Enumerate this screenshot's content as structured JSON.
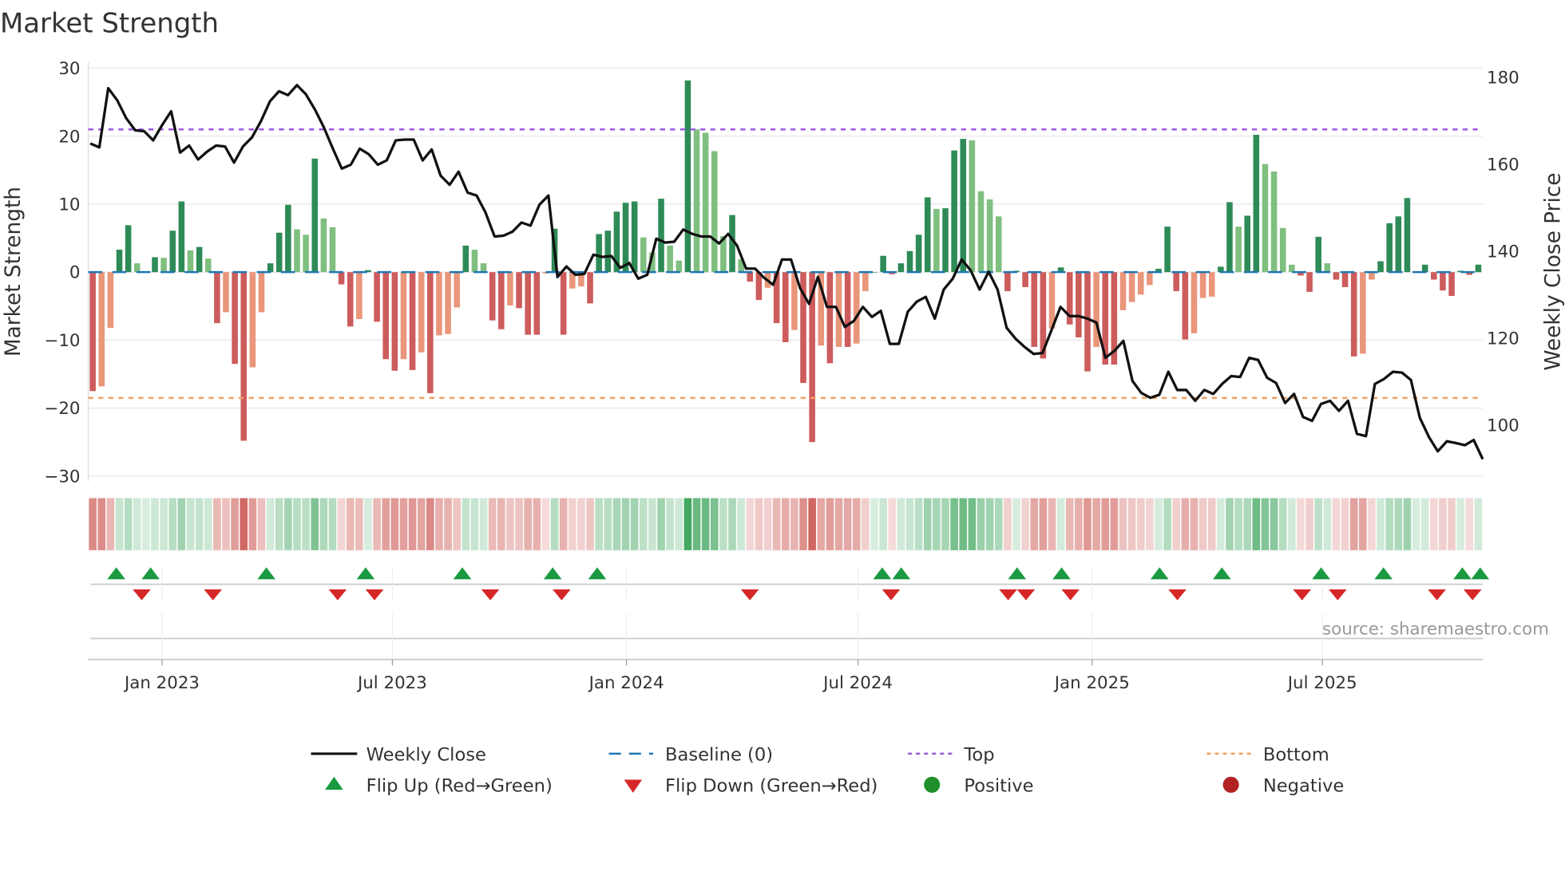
{
  "chart_data": {
    "type": "bar",
    "title": "Market Strength",
    "ylabel": "Market Strength",
    "y2label": "Weekly Close Price",
    "ylim": [
      -30,
      30
    ],
    "y2lim": [
      88.3,
      182.1
    ],
    "yticks": [
      30,
      20,
      10,
      0,
      -10,
      -20,
      -30
    ],
    "ytick_labels": [
      "30",
      "20",
      "10",
      "0",
      "−10",
      "−20",
      "−30"
    ],
    "y2ticks": [
      180,
      160,
      140,
      120,
      100
    ],
    "x_range": [
      "2022-11-04",
      "2025-11-04"
    ],
    "xticks": [
      {
        "date": "2023-01-01",
        "label": "Jan 2023"
      },
      {
        "date": "2023-07-01",
        "label": "Jul 2023"
      },
      {
        "date": "2024-01-01",
        "label": "Jan 2024"
      },
      {
        "date": "2024-07-01",
        "label": "Jul 2024"
      },
      {
        "date": "2025-01-01",
        "label": "Jan 2025"
      },
      {
        "date": "2025-07-01",
        "label": "Jul 2025"
      }
    ],
    "top_level": 21,
    "bottom_level": -18.5,
    "baseline": 0,
    "strength": [
      -17.5,
      -16.8,
      -8.2,
      3.3,
      6.9,
      1.3,
      0,
      2.2,
      2.1,
      6.1,
      10.4,
      3.2,
      3.7,
      2.0,
      -7.5,
      -5.9,
      -13.5,
      -24.8,
      -14,
      -5.9,
      1.3,
      5.8,
      9.9,
      6.3,
      5.5,
      16.7,
      7.9,
      6.6,
      -1.8,
      -8,
      -6.9,
      0.3,
      -7.3,
      -12.8,
      -14.5,
      -12.8,
      -14.4,
      -11.8,
      -17.8,
      -9.3,
      -9.1,
      -5.2,
      3.9,
      3.3,
      1.3,
      -7.1,
      -8.4,
      -4.9,
      -5.3,
      -9.2,
      -9.2,
      -0.2,
      6.4,
      -9.2,
      -2.4,
      -2.1,
      -4.6,
      5.6,
      6.1,
      8.9,
      10.2,
      10.4,
      5.1,
      2.9,
      10.8,
      3.9,
      1.7,
      28.2,
      21,
      20.5,
      17.8,
      5.3,
      8.4,
      1.9,
      -1.4,
      -4.1,
      -2.3,
      -7.5,
      -10.3,
      -8.5,
      -16.3,
      -25,
      -10.8,
      -13.4,
      -11,
      -11,
      -10.5,
      -2.8,
      0,
      2.4,
      -0.3,
      1.3,
      3.1,
      5.5,
      11,
      9.3,
      9.4,
      17.9,
      19.6,
      19.4,
      11.9,
      10.7,
      8.2,
      -2.8,
      0.2,
      -2.2,
      -11,
      -12.7,
      -8.3,
      0.7,
      -7.7,
      -9.6,
      -14.6,
      -11,
      -13.6,
      -13.6,
      -5.6,
      -4.4,
      -3.3,
      -1.9,
      0.5,
      6.7,
      -2.8,
      -9.9,
      -9,
      -3.8,
      -3.6,
      0.8,
      10.3,
      6.7,
      8.3,
      20.2,
      15.9,
      14.8,
      6.5,
      1.1,
      -0.5,
      -2.9,
      5.2,
      1.3,
      -1.1,
      -2.2,
      -12.4,
      -12,
      -1.1,
      1.6,
      7.2,
      8.2,
      10.9,
      0,
      1.1,
      -1.1,
      -2.7,
      -3.5,
      0.2,
      -0.4,
      1.1
    ],
    "weekly_close": [
      164.8,
      163.9,
      177.5,
      174.7,
      170.6,
      167.8,
      167.6,
      165.5,
      169,
      172.2,
      162.7,
      164.3,
      161.1,
      162.9,
      164.3,
      164.1,
      160.4,
      164.1,
      166.2,
      169.9,
      174.5,
      176.8,
      175.9,
      178.2,
      176.1,
      172.6,
      168.5,
      163.6,
      159,
      159.9,
      163.6,
      162.3,
      159.9,
      160.9,
      165.5,
      165.7,
      165.7,
      160.9,
      163.4,
      157.4,
      155.3,
      158.3,
      153.5,
      152.8,
      148.9,
      143.4,
      143.6,
      144.5,
      146.6,
      145.9,
      150.7,
      152.8,
      134.1,
      136.5,
      134.6,
      134.8,
      139.2,
      138.7,
      138.9,
      136.2,
      137.3,
      133.7,
      134.6,
      142.9,
      142,
      142.2,
      145,
      144,
      143.4,
      143.4,
      141.8,
      144,
      141.3,
      136,
      136,
      133.9,
      132.3,
      138.1,
      138.1,
      131.6,
      127.9,
      134.1,
      127.2,
      127.2,
      122.6,
      124,
      127.2,
      124.9,
      126.3,
      118.7,
      118.7,
      126.1,
      128.4,
      129.5,
      124.5,
      131.2,
      133.7,
      138.1,
      135.6,
      131.2,
      135.3,
      131.2,
      122.4,
      119.9,
      118,
      116.4,
      116.6,
      121.9,
      127.2,
      125.1,
      125.1,
      124.5,
      123.6,
      115.5,
      117.1,
      119.4,
      110.2,
      107.4,
      106.3,
      107,
      112.3,
      108.1,
      108.1,
      105.6,
      108.1,
      107.2,
      109.5,
      111.3,
      111.1,
      115.5,
      115,
      110.9,
      109.7,
      105.1,
      107.2,
      101.9,
      101,
      104.9,
      105.6,
      103.3,
      105.6,
      98,
      97.5,
      109.5,
      110.6,
      112.3,
      112.1,
      110.4,
      101.7,
      97.3,
      94,
      96.3,
      95.9,
      95.4,
      96.6,
      92.2
    ],
    "flip_up": [
      "2022-11-26",
      "2022-12-23",
      "2023-03-24",
      "2023-06-10",
      "2023-08-25",
      "2023-11-04",
      "2023-12-09",
      "2024-07-20",
      "2024-08-04",
      "2024-11-03",
      "2024-12-08",
      "2025-02-23",
      "2025-04-13",
      "2025-06-30",
      "2025-08-18",
      "2025-10-19",
      "2025-11-02"
    ],
    "flip_down": [
      "2022-12-16",
      "2023-02-10",
      "2023-05-19",
      "2023-06-17",
      "2023-09-16",
      "2023-11-11",
      "2024-04-07",
      "2024-07-27",
      "2024-10-27",
      "2024-11-10",
      "2024-12-15",
      "2025-03-09",
      "2025-06-15",
      "2025-07-13",
      "2025-09-29",
      "2025-10-27"
    ],
    "colors": {
      "pos_strong": "#2e8b57",
      "pos_weak": "#7fbf7f",
      "neg_strong": "#cd5c5c",
      "neg_weak": "#e9967a",
      "line": "#111111",
      "baseline": "#1f77b4",
      "top": "#9b59e6",
      "bottom": "#f0a060",
      "flip_up": "#1a9a40",
      "flip_down": "#d62728",
      "positive": "#1f8f2a",
      "negative": "#b22222"
    },
    "legend": {
      "weekly_close": "Weekly Close",
      "baseline": "Baseline (0)",
      "top": "Top",
      "bottom": "Bottom",
      "flip_up": "Flip Up (Red→Green)",
      "flip_down": "Flip Down (Green→Red)",
      "positive": "Positive",
      "negative": "Negative"
    },
    "source": "source: sharemaestro.com"
  }
}
